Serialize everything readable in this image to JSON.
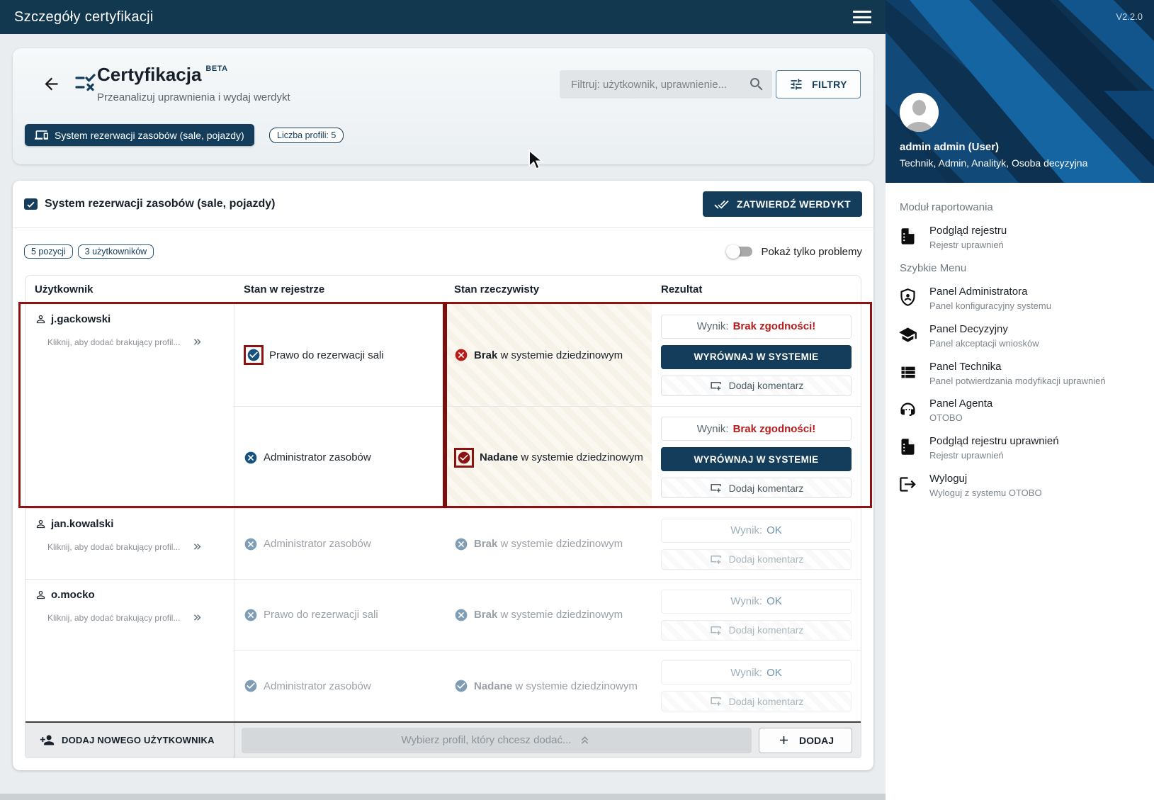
{
  "topbar": {
    "title": "Szczegóły certyfikacji"
  },
  "header": {
    "title": "Certyfikacja",
    "beta": "BETA",
    "subtitle": "Przeanalizuj uprawnienia i wydaj werdykt",
    "search_placeholder": "Filtruj: użytkownik, uprawnienie...",
    "filter_button": "FILTRY",
    "system_chip": "System rezerwacji zasobów (sale, pojazdy)",
    "profiles_chip": "Liczba profili: 5"
  },
  "panel": {
    "title": "System rezerwacji zasobów (sale, pojazdy)",
    "approve_button": "ZATWIERDŹ WERDYKT",
    "chip_positions": "5 pozycji",
    "chip_users": "3 użytkowników",
    "toggle_label": "Pokaż tylko problemy"
  },
  "table": {
    "headers": {
      "user": "Użytkownik",
      "registry": "Stan w rejestrze",
      "actual": "Stan rzeczywisty",
      "result": "Rezultat"
    },
    "add_profile_hint": "Kliknij, aby dodać brakujący profil...",
    "labels": {
      "result_prefix": "Wynik:",
      "result_mismatch": "Brak zgodności!",
      "result_ok": "OK",
      "align_button": "WYRÓWNAJ W SYSTEMIE",
      "comment_button": "Dodaj komentarz"
    },
    "groups": [
      {
        "user": "j.gackowski",
        "rows": [
          {
            "registry_text": "Prawo do rezerwacji sali",
            "actual_bold": "Brak",
            "actual_rest": " w systemie dziedzinowym"
          },
          {
            "registry_text": "Administrator zasobów",
            "actual_bold": "Nadane",
            "actual_rest": " w systemie dziedzinowym"
          }
        ]
      },
      {
        "user": "jan.kowalski",
        "rows": [
          {
            "registry_text": "Administrator zasobów",
            "actual_bold": "Brak",
            "actual_rest": " w systemie dziedzinowym"
          }
        ]
      },
      {
        "user": "o.mocko",
        "rows": [
          {
            "registry_text": "Prawo do rezerwacji sali",
            "actual_bold": "Brak",
            "actual_rest": " w systemie dziedzinowym"
          },
          {
            "registry_text": "Administrator zasobów",
            "actual_bold": "Nadane",
            "actual_rest": " w systemie dziedzinowym"
          }
        ]
      }
    ]
  },
  "footer": {
    "add_user_button": "DODAJ NOWEGO UŻYTKOWNIKA",
    "select_placeholder": "Wybierz profil, który chcesz dodać...",
    "add_button": "DODAJ"
  },
  "sidebar": {
    "version": "V2.2.0",
    "user": {
      "name": "admin admin (User)",
      "roles": "Technik, Admin, Analityk, Osoba decyzyjna"
    },
    "sections": [
      {
        "header": "Moduł raportowania",
        "items": [
          {
            "icon": "document-icon",
            "title": "Podgląd rejestru",
            "subtitle": "Rejestr uprawnień"
          }
        ]
      },
      {
        "header": "Szybkie Menu",
        "items": [
          {
            "icon": "shield-person-icon",
            "title": "Panel Administratora",
            "subtitle": "Panel konfiguracyjny systemu"
          },
          {
            "icon": "graduation-cap-icon",
            "title": "Panel Decyzyjny",
            "subtitle": "Panel akceptacji wniosków"
          },
          {
            "icon": "list-icon",
            "title": "Panel Technika",
            "subtitle": "Panel potwierdzania modyfikacji uprawnień"
          },
          {
            "icon": "headset-icon",
            "title": "Panel Agenta",
            "subtitle": "OTOBO"
          },
          {
            "icon": "document-icon",
            "title": "Podgląd rejestru uprawnień",
            "subtitle": "Rejestr uprawnień"
          },
          {
            "icon": "logout-icon",
            "title": "Wyloguj",
            "subtitle": "Wyloguj z systemu OTOBO"
          }
        ]
      }
    ]
  },
  "colors": {
    "accent_navy": "#133d5b",
    "annotation_red": "#8e1212",
    "error_red": "#b71c1c",
    "muted_blue": "#7f9cb5"
  }
}
